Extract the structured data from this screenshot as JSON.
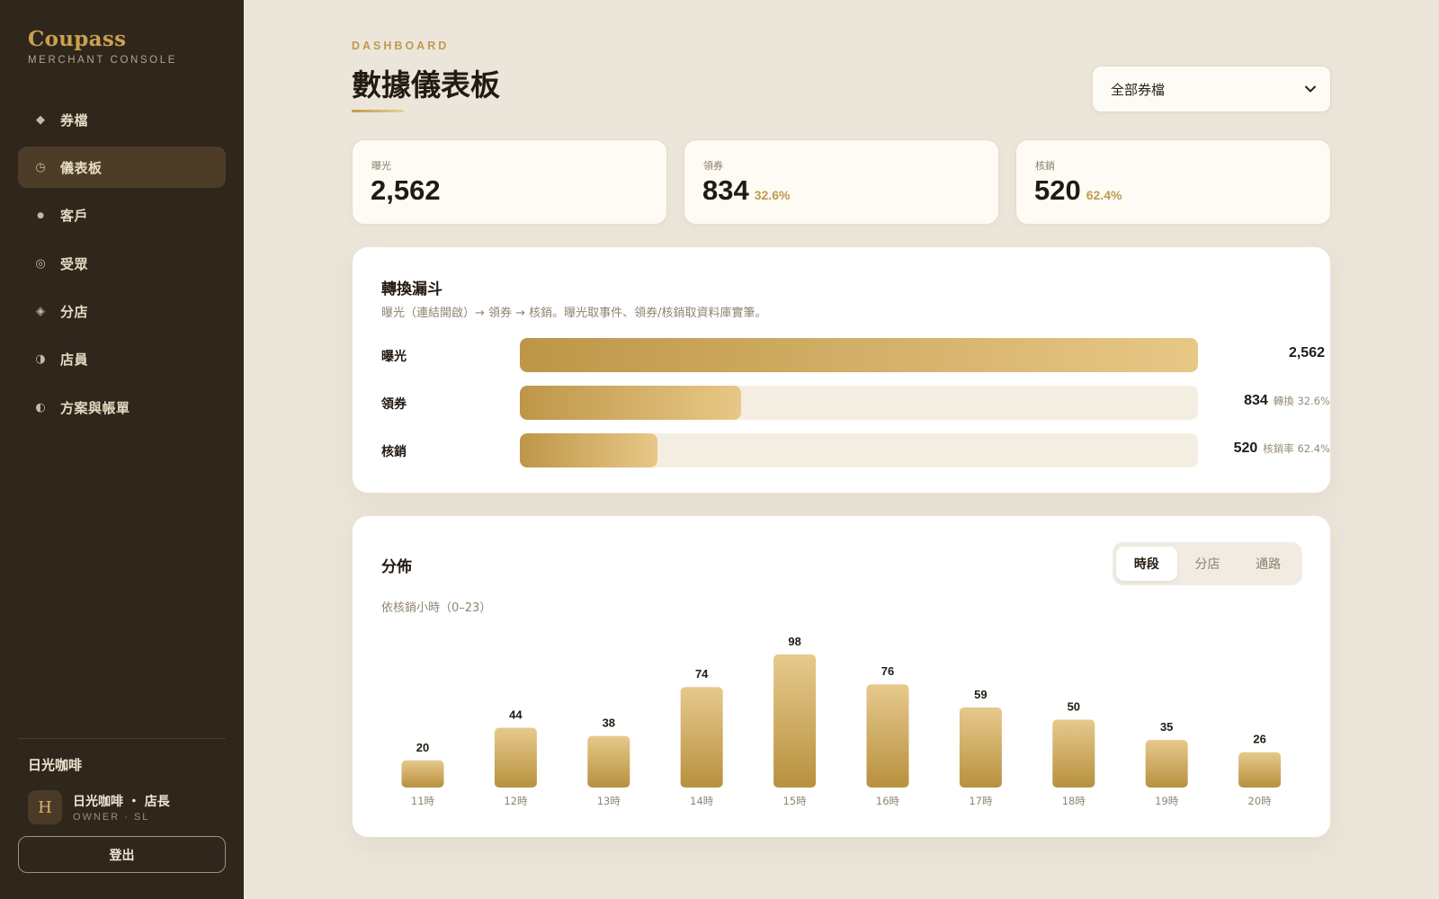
{
  "sidebar": {
    "brand": "Coupass",
    "brand_sub": "MERCHANT CONSOLE",
    "items": [
      {
        "label": "券檔",
        "icon": "◆"
      },
      {
        "label": "儀表板",
        "icon": "◷"
      },
      {
        "label": "客戶",
        "icon": "●"
      },
      {
        "label": "受眾",
        "icon": "◎"
      },
      {
        "label": "分店",
        "icon": "◈"
      },
      {
        "label": "店員",
        "icon": "◑"
      },
      {
        "label": "方案與帳單",
        "icon": "◐"
      }
    ],
    "active_index": 1,
    "store_name": "日光咖啡",
    "avatar_letter": "H",
    "user_name": "日光咖啡 ・ 店長",
    "user_role": "OWNER · SL",
    "logout": "登出"
  },
  "header": {
    "eyebrow": "DASHBOARD",
    "title": "數據儀表板",
    "select_value": "全部券檔"
  },
  "stats": [
    {
      "label": "曝光",
      "value": "2,562",
      "pct": ""
    },
    {
      "label": "領券",
      "value": "834",
      "pct": "32.6%"
    },
    {
      "label": "核銷",
      "value": "520",
      "pct": "62.4%"
    }
  ],
  "funnel": {
    "title": "轉換漏斗",
    "subtitle": "曝光（連結開啟）→ 領券 → 核銷。曝光取事件、領券/核銷取資料庫實筆。",
    "rows": [
      {
        "label": "曝光",
        "value": "2,562",
        "note": "",
        "fraction": 1.0
      },
      {
        "label": "領券",
        "value": "834",
        "note": "轉換 32.6%",
        "fraction": 0.326
      },
      {
        "label": "核銷",
        "value": "520",
        "note": "核銷率 62.4%",
        "fraction": 0.203
      }
    ]
  },
  "distribution": {
    "title": "分佈",
    "subtitle": "依核銷小時（0–23）",
    "tabs": [
      "時段",
      "分店",
      "通路"
    ],
    "active_tab": 0
  },
  "colors": {
    "accent": "#c09a4e",
    "sidebar_bg": "#2f261c",
    "page_bg": "#ece6da",
    "bar_light": "#e6c98c",
    "bar_dark": "#b8913f"
  },
  "chart_data": {
    "type": "bar",
    "categories": [
      "11時",
      "12時",
      "13時",
      "14時",
      "15時",
      "16時",
      "17時",
      "18時",
      "19時",
      "20時"
    ],
    "values": [
      20,
      44,
      38,
      74,
      98,
      76,
      59,
      50,
      35,
      26
    ],
    "title": "",
    "xlabel": "",
    "ylabel": "",
    "ylim": [
      0,
      98
    ],
    "grid": false,
    "data_labels": true
  }
}
